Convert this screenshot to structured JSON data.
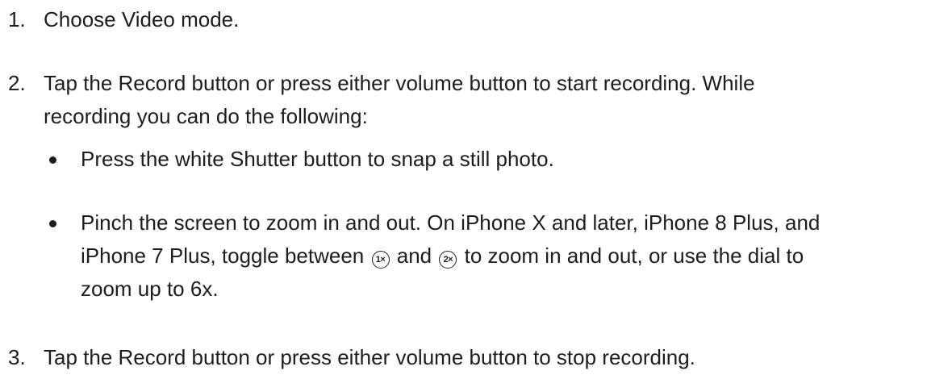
{
  "steps": [
    {
      "number": "1.",
      "text": "Choose Video mode."
    },
    {
      "number": "2.",
      "line1": "Tap the Record button or press either volume button to start recording. While",
      "line2": "recording you can do the following:",
      "bullets": [
        {
          "text": "Press the white Shutter button to snap a still photo."
        },
        {
          "line1": "Pinch the screen to zoom in and out. On iPhone X and later, iPhone 8 Plus, and",
          "line2_before": "iPhone 7 Plus, toggle between",
          "icon1_text": "1×",
          "line2_middle": "and",
          "icon2_text": "2×",
          "line2_after": "to zoom in and out, or use the dial to",
          "line3": "zoom up to 6x."
        }
      ]
    },
    {
      "number": "3.",
      "text": "Tap the Record button or press either volume button to stop recording."
    }
  ],
  "icons": {
    "zoom_1x": "zoom-1x-icon",
    "zoom_2x": "zoom-2x-icon"
  }
}
